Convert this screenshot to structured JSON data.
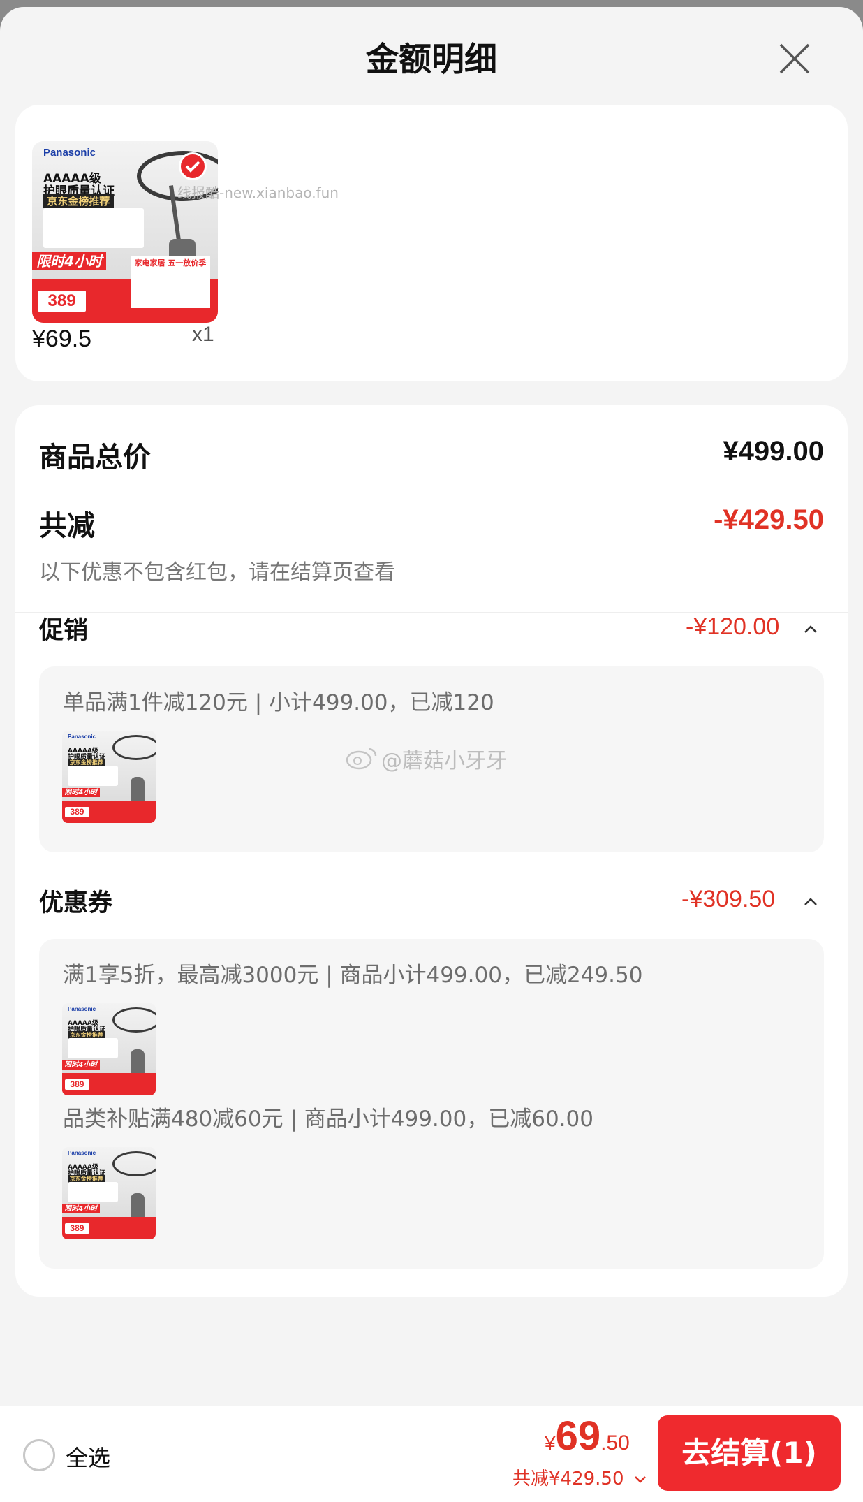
{
  "header": {
    "title": "金额明细",
    "close_icon": "close-icon"
  },
  "product": {
    "unit_price": "¥69.5",
    "quantity": "x1",
    "thumb": {
      "brand": "Panasonic",
      "line1": "AAAAA级",
      "line2": "护眼质量认证",
      "recommend": "京东金榜推荐",
      "limit": "限时4小时",
      "price": "389",
      "band": "家电家居 五一放价季"
    },
    "watermark": "线报酷-new.xianbao.fun"
  },
  "summary": {
    "total_label": "商品总价",
    "total_value": "¥499.00",
    "reduce_label": "共减",
    "reduce_value": "-¥429.50",
    "note": "以下优惠不包含红包，请在结算页查看"
  },
  "promotion": {
    "label": "促销",
    "value": "-¥120.00",
    "detail": "单品满1件减120元 | 小计499.00，已减120"
  },
  "coupon": {
    "label": "优惠券",
    "value": "-¥309.50",
    "details": [
      "满1享5折，最高减3000元 | 商品小计499.00，已减249.50",
      "品类补贴满480减60元 | 商品小计499.00，已减60.00"
    ]
  },
  "watermark2": "@蘑菇小牙牙",
  "footer": {
    "select_all": "全选",
    "currency": "¥",
    "price_int": "69",
    "price_dec": ".50",
    "saved": "共减¥429.50",
    "checkout": "去结算(1)"
  },
  "colors": {
    "accent": "#e03225",
    "button": "#ef2a2e"
  }
}
